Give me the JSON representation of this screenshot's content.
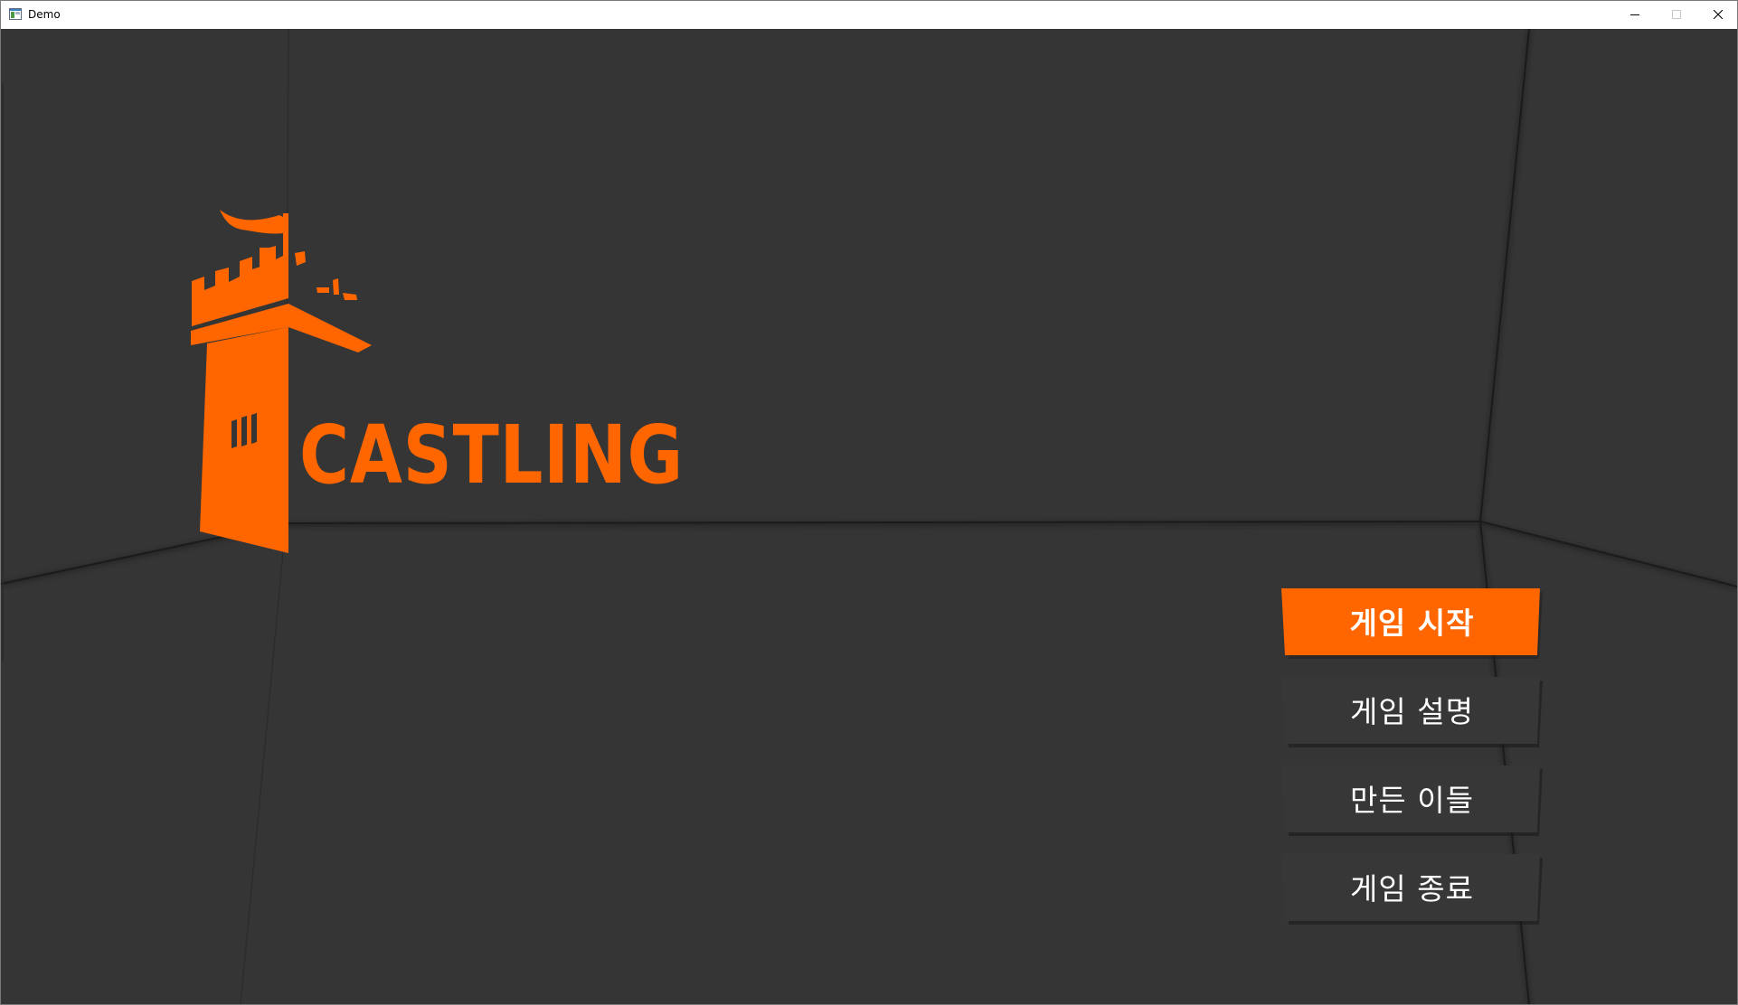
{
  "window": {
    "title": "Demo",
    "icon": "app-window-icon",
    "controls": [
      "minimize-icon",
      "maximize-icon",
      "close-icon"
    ]
  },
  "colors": {
    "background": "#353535",
    "accent": "#ff6600",
    "button_dark": "#353535",
    "text": "#ffffff"
  },
  "logo": {
    "text": "CASTLING",
    "icon": "castle-tower-icon"
  },
  "menu": {
    "items": [
      {
        "label": "게임 시작",
        "state": "active"
      },
      {
        "label": "게임 설명",
        "state": "normal"
      },
      {
        "label": "만든 이들",
        "state": "normal"
      },
      {
        "label": "게임 종료",
        "state": "normal"
      }
    ]
  }
}
